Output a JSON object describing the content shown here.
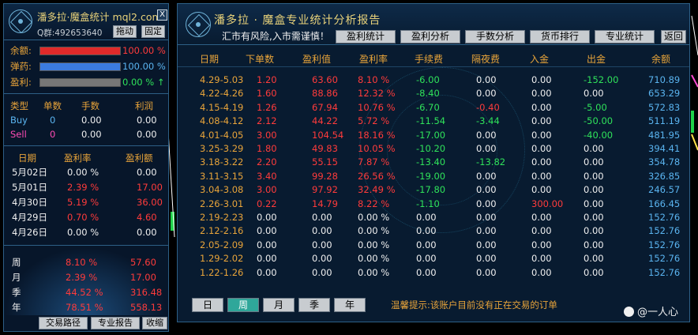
{
  "left": {
    "title": "潘多拉·魔盒统计 mql2.com",
    "close_label": "X",
    "qq": "Q群:492653640",
    "drag_label": "拖动",
    "fix_label": "固定",
    "balance": {
      "label": "余额:",
      "value": "100.00 %",
      "fill": 1.0,
      "color": "#e02a2a"
    },
    "ammo": {
      "label": "弹药:",
      "value": "100.00 %",
      "fill": 1.0,
      "color": "#3b7be0"
    },
    "profit": {
      "label": "盈利:",
      "value": "0.00 % ↑",
      "fill": 1.0,
      "color": "#777777"
    },
    "type_header": [
      "类型",
      "单数",
      "手数",
      "利润"
    ],
    "types": [
      {
        "name": "Buy",
        "count": "0",
        "lots": "0.00",
        "profit": "0.00"
      },
      {
        "name": "Sell",
        "count": "0",
        "lots": "0.00",
        "profit": "0.00"
      }
    ],
    "daily_header": [
      "日期",
      "盈利率",
      "盈利额"
    ],
    "daily": [
      {
        "date": "5月02日",
        "rate": "0.00 %",
        "amount": "0.00",
        "pos": false
      },
      {
        "date": "5月01日",
        "rate": "2.39 %",
        "amount": "17.00",
        "pos": true
      },
      {
        "date": "4月30日",
        "rate": "5.19 %",
        "amount": "36.00",
        "pos": true
      },
      {
        "date": "4月29日",
        "rate": "0.70 %",
        "amount": "4.60",
        "pos": true
      },
      {
        "date": "4月26日",
        "rate": "0.00 %",
        "amount": "0.00",
        "pos": false
      }
    ],
    "periods": [
      {
        "label": "周",
        "rate": "8.10 %",
        "amount": "57.60"
      },
      {
        "label": "月",
        "rate": "2.39 %",
        "amount": "17.00"
      },
      {
        "label": "季",
        "rate": "44.52 %",
        "amount": "316.48"
      },
      {
        "label": "年",
        "rate": "78.51 %",
        "amount": "558.13"
      }
    ],
    "footer_buttons": [
      "交易路径",
      "专业报告",
      "收缩"
    ]
  },
  "report": {
    "title": "潘多拉 · 魔盒专业统计分析报告",
    "warning": "汇市有风险,入市需谨慎！",
    "tabs": [
      "盈利统计",
      "盈利分析",
      "手数分析",
      "货币排行",
      "专业统计"
    ],
    "back_label": "返回",
    "columns": [
      "日期",
      "下单数",
      "盈利值",
      "盈利率",
      "手续费",
      "隔夜费",
      "入金",
      "出金",
      "余额"
    ],
    "rows": [
      [
        "4.29-5.03",
        "1.20",
        "63.60",
        "8.10 %",
        "-6.00",
        "0.00",
        "0.00",
        "-152.00",
        "710.89"
      ],
      [
        "4.22-4.26",
        "1.60",
        "88.86",
        "12.32 %",
        "-8.40",
        "0.00",
        "0.00",
        "0.00",
        "653.29"
      ],
      [
        "4.15-4.19",
        "1.26",
        "67.94",
        "10.76 %",
        "-6.70",
        "-0.40",
        "0.00",
        "-5.00",
        "572.83"
      ],
      [
        "4.08-4.12",
        "2.12",
        "44.22",
        "5.72 %",
        "-11.54",
        "-3.44",
        "0.00",
        "-50.00",
        "511.19"
      ],
      [
        "4.01-4.05",
        "3.00",
        "104.54",
        "18.16 %",
        "-17.00",
        "0.00",
        "0.00",
        "-40.00",
        "481.95"
      ],
      [
        "3.25-3.29",
        "1.80",
        "49.83",
        "10.05 %",
        "-10.20",
        "0.00",
        "0.00",
        "0.00",
        "394.41"
      ],
      [
        "3.18-3.22",
        "2.20",
        "55.15",
        "7.87 %",
        "-13.40",
        "-13.82",
        "0.00",
        "0.00",
        "354.78"
      ],
      [
        "3.11-3.15",
        "3.40",
        "99.28",
        "26.56 %",
        "-19.00",
        "0.00",
        "0.00",
        "0.00",
        "326.85"
      ],
      [
        "3.04-3.08",
        "3.00",
        "97.92",
        "32.49 %",
        "-17.80",
        "0.00",
        "0.00",
        "0.00",
        "246.57"
      ],
      [
        "2.26-3.01",
        "0.22",
        "14.79",
        "8.22 %",
        "-1.10",
        "0.00",
        "300.00",
        "0.00",
        "166.45"
      ],
      [
        "2.19-2.23",
        "0.00",
        "0.00",
        "0.00 %",
        "0.00",
        "0.00",
        "0.00",
        "0.00",
        "152.76"
      ],
      [
        "2.12-2.16",
        "0.00",
        "0.00",
        "0.00 %",
        "0.00",
        "0.00",
        "0.00",
        "0.00",
        "152.76"
      ],
      [
        "2.05-2.09",
        "0.00",
        "0.00",
        "0.00 %",
        "0.00",
        "0.00",
        "0.00",
        "0.00",
        "152.76"
      ],
      [
        "1.29-2.02",
        "0.00",
        "0.00",
        "0.00 %",
        "0.00",
        "0.00",
        "0.00",
        "0.00",
        "152.76"
      ],
      [
        "1.22-1.26",
        "0.00",
        "0.00",
        "0.00 %",
        "0.00",
        "0.00",
        "0.00",
        "0.00",
        "152.76"
      ]
    ],
    "period_buttons": [
      "日",
      "周",
      "月",
      "季",
      "年"
    ],
    "active_period": "周",
    "tip": "温馨提示:该账户目前没有正在交易的订单"
  },
  "watermark": "@一人心",
  "colors": {
    "positive": "#ff3b3b",
    "negative": "#2fe25a",
    "neutral": "#f0f0f0",
    "header": "#e8a43a",
    "balance": "#5ab4f0",
    "deposit": "#ff3b3b"
  }
}
